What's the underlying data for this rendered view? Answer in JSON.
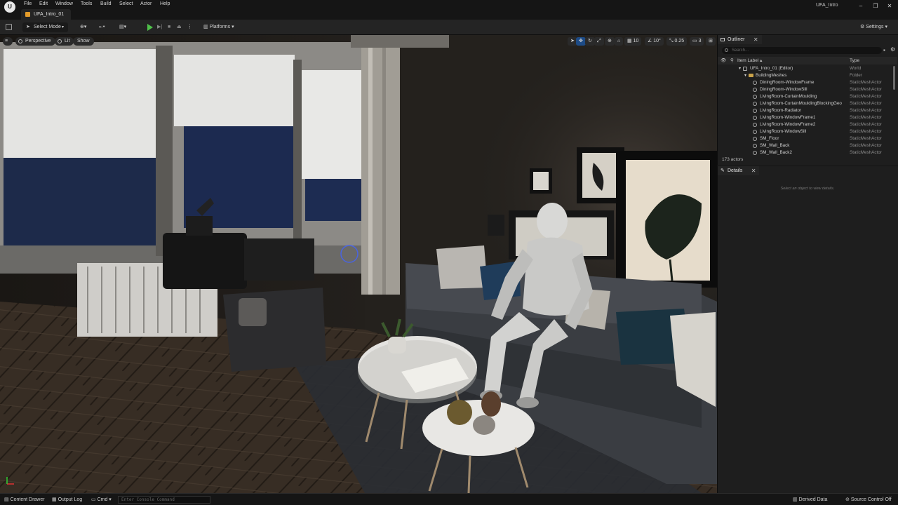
{
  "menubar": {
    "items": [
      "File",
      "Edit",
      "Window",
      "Tools",
      "Build",
      "Select",
      "Actor",
      "Help"
    ],
    "level_tab": "UFA_Intro_01",
    "project_name": "UFA_Intro"
  },
  "toolbar": {
    "select_mode": "Select Mode",
    "platforms": "Platforms",
    "settings": "Settings"
  },
  "viewport": {
    "view_mode": "Perspective",
    "lit_mode": "Lit",
    "show": "Show",
    "grid_snap": "10",
    "rotation_snap": "10°",
    "scale_snap": "0.25",
    "camera_speed": "3"
  },
  "outliner": {
    "tab_label": "Outliner",
    "search_placeholder": "Search...",
    "col_label": "Item Label ▴",
    "col_type": "Type",
    "rows": [
      {
        "label": "UFA_Intro_01 (Editor)",
        "type": "World",
        "indent": 40
      },
      {
        "label": "BuildingMeshes",
        "type": "Folder",
        "indent": 48
      },
      {
        "label": "DiningRoom-WindowFrame",
        "type": "StaticMeshActor",
        "indent": 60
      },
      {
        "label": "DiningRoom-WindowSill",
        "type": "StaticMeshActor",
        "indent": 60
      },
      {
        "label": "LivingRoom-CurtainMoulding",
        "type": "StaticMeshActor",
        "indent": 60
      },
      {
        "label": "LivingRoom-CurtainMouldingBlockingGeo",
        "type": "StaticMeshActor",
        "indent": 60
      },
      {
        "label": "LivingRoom-Radiator",
        "type": "StaticMeshActor",
        "indent": 60
      },
      {
        "label": "LivingRoom-WindowFrame1",
        "type": "StaticMeshActor",
        "indent": 60
      },
      {
        "label": "LivingRoom-WindowFrame2",
        "type": "StaticMeshActor",
        "indent": 60
      },
      {
        "label": "LivingRoom-WindowSill",
        "type": "StaticMeshActor",
        "indent": 60
      },
      {
        "label": "SM_Floor",
        "type": "StaticMeshActor",
        "indent": 60
      },
      {
        "label": "SM_Wall_Back",
        "type": "StaticMeshActor",
        "indent": 60
      },
      {
        "label": "SM_Wall_Back2",
        "type": "StaticMeshActor",
        "indent": 60
      }
    ],
    "actor_count": "173 actors"
  },
  "details": {
    "tab_label": "Details",
    "empty_text": "Select an object to view details."
  },
  "statusbar": {
    "content_drawer": "Content Drawer",
    "output_log": "Output Log",
    "cmd": "Cmd",
    "console_placeholder": "Enter Console Command",
    "derived_data": "Derived Data",
    "source_control": "Source Control Off"
  }
}
